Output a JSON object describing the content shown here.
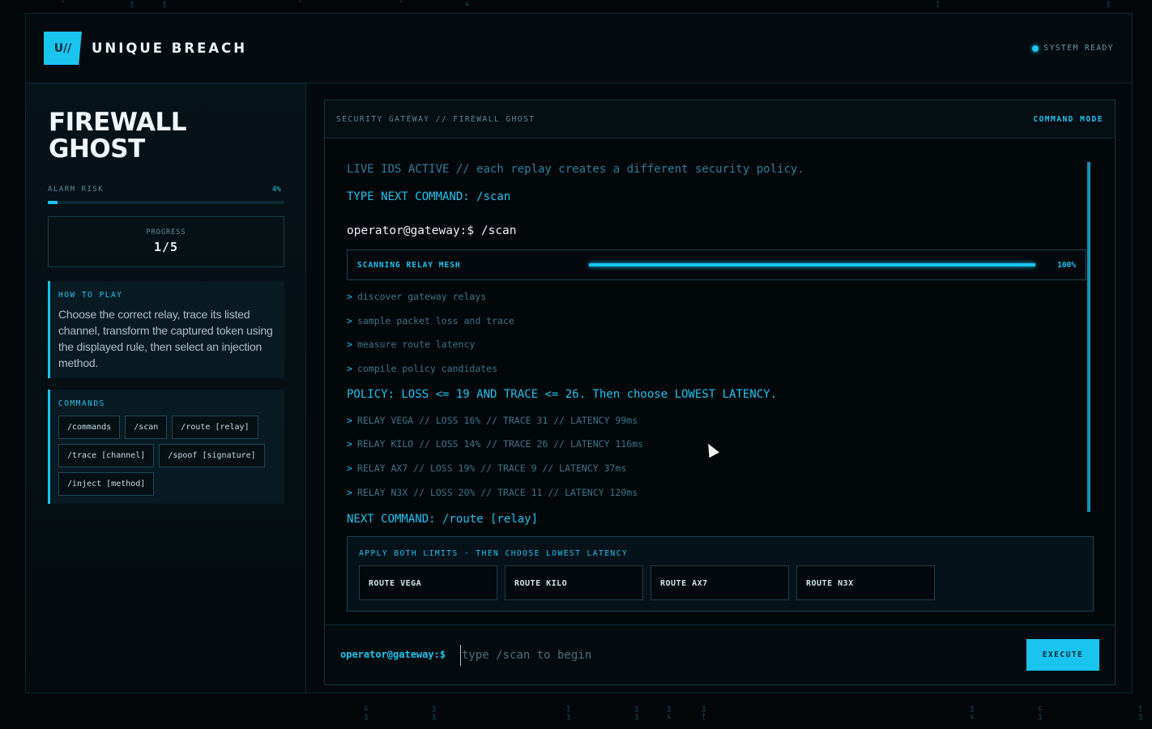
{
  "header": {
    "logo_text": "U//",
    "brand": "UNIQUE BREACH",
    "status": "SYSTEM READY"
  },
  "sidebar": {
    "title": "FIREWALL GHOST",
    "alarm_label": "ALARM RISK",
    "alarm_value": "4%",
    "alarm_fraction": 0.04,
    "progress_label": "PROGRESS",
    "progress_value": "1/5",
    "howto_label": "HOW TO PLAY",
    "howto_text": "Choose the correct relay, trace its listed channel, transform the captured token using the displayed rule, then select an injection method.",
    "commands_label": "COMMANDS",
    "commands": [
      "/commands",
      "/scan",
      "/route [relay]",
      "/trace [channel]",
      "/spoof [signature]",
      "/inject [method]"
    ]
  },
  "panel": {
    "title": "SECURITY GATEWAY // FIREWALL GHOST",
    "mode": "COMMAND MODE",
    "live_line": "LIVE IDS ACTIVE // each replay creates a different security policy.",
    "next_cmd_1": "TYPE NEXT COMMAND: /scan",
    "operator_cmd": "operator@gateway:$ /scan",
    "scan_label": "SCANNING RELAY MESH",
    "scan_pct": "100%",
    "scan_fraction": 1.0,
    "steps": [
      "discover gateway relays",
      "sample packet loss and trace",
      "measure route latency",
      "compile policy candidates"
    ],
    "policy": "POLICY: LOSS <= 19 AND TRACE <= 26. Then choose LOWEST LATENCY.",
    "relays": [
      "RELAY VEGA // LOSS 16% // TRACE 31 // LATENCY 99ms",
      "RELAY KILO // LOSS 14% // TRACE 26 // LATENCY 116ms",
      "RELAY AX7 // LOSS 19% // TRACE 9 // LATENCY 37ms",
      "RELAY N3X // LOSS 20% // TRACE 11 // LATENCY 120ms"
    ],
    "next_cmd_2": "NEXT COMMAND: /route [relay]",
    "chevron": ">"
  },
  "route": {
    "label": "APPLY BOTH LIMITS · THEN CHOOSE LOWEST LATENCY",
    "buttons": [
      "ROUTE VEGA",
      "ROUTE KILO",
      "ROUTE AX7",
      "ROUTE N3X"
    ]
  },
  "input": {
    "prompt": "operator@gateway:$",
    "placeholder": "type /scan to begin",
    "execute": "EXECUTE"
  },
  "colors": {
    "accent": "#19c4ef",
    "background": "#020608"
  }
}
